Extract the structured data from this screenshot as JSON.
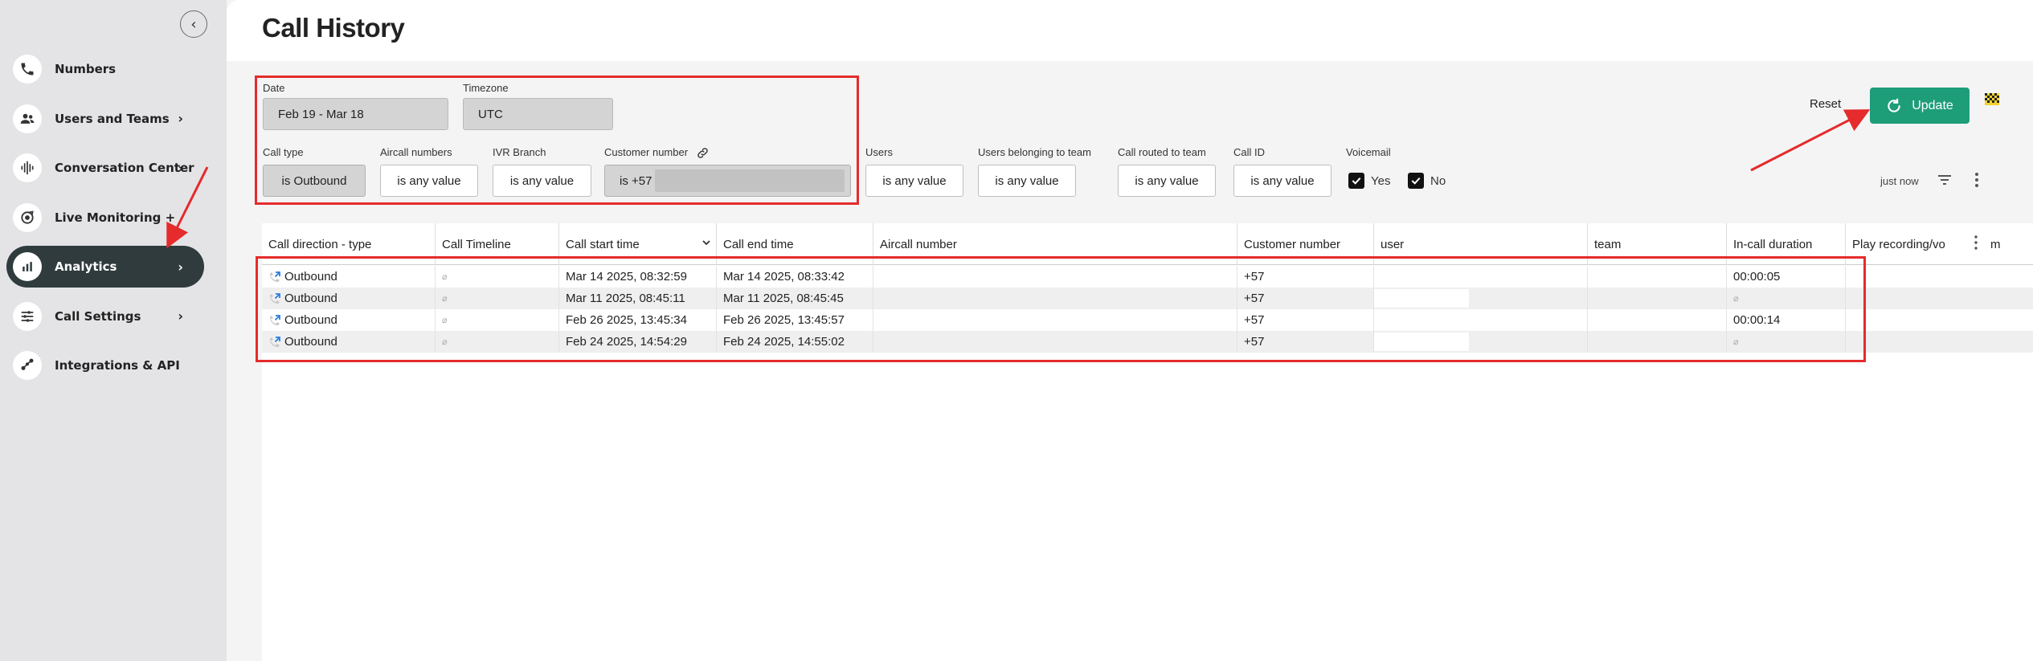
{
  "sidebar": {
    "collapse_glyph": "‹",
    "items": [
      {
        "label": "Numbers",
        "icon": "phone-icon"
      },
      {
        "label": "Users and Teams",
        "icon": "users-icon",
        "chevron": "›"
      },
      {
        "label": "Conversation Center",
        "icon": "waveform-icon",
        "chevron": "›"
      },
      {
        "label": "Live Monitoring +",
        "icon": "monitor-icon"
      },
      {
        "label": "Analytics",
        "icon": "analytics-icon",
        "chevron": "›",
        "active": true
      },
      {
        "label": "Call Settings",
        "icon": "sliders-icon",
        "chevron": "›"
      },
      {
        "label": "Integrations & API",
        "icon": "integrations-icon"
      }
    ]
  },
  "header": {
    "title": "Call History"
  },
  "filters": {
    "date": {
      "label": "Date",
      "value": "Feb 19 - Mar 18"
    },
    "timezone": {
      "label": "Timezone",
      "value": "UTC"
    },
    "call_type": {
      "label": "Call type",
      "value": "is Outbound"
    },
    "aircall_numbers": {
      "label": "Aircall numbers",
      "value": "is any value"
    },
    "ivr_branch": {
      "label": "IVR Branch",
      "value": "is any value"
    },
    "customer_number": {
      "label": "Customer number",
      "value": "is +57"
    },
    "users": {
      "label": "Users",
      "value": "is any value"
    },
    "users_team": {
      "label": "Users belonging to team",
      "value": "is any value"
    },
    "routed_team": {
      "label": "Call routed to team",
      "value": "is any value"
    },
    "call_id": {
      "label": "Call ID",
      "value": "is any value"
    },
    "voicemail": {
      "label": "Voicemail",
      "yes": "Yes",
      "no": "No"
    }
  },
  "actions": {
    "reset": "Reset",
    "update": "Update",
    "refreshed": "just now"
  },
  "table": {
    "columns": [
      "Call direction - type",
      "Call Timeline",
      "Call start time",
      "Call end time",
      "Aircall number",
      "Customer number",
      "user",
      "team",
      "In-call duration",
      "Play recording/vo",
      "m"
    ],
    "empty_glyph": "⌀",
    "rows": [
      {
        "direction": "Outbound",
        "start": "Mar 14 2025, 08:32:59",
        "end": "Mar 14 2025, 08:33:42",
        "customer": "+57",
        "duration": "00:00:05"
      },
      {
        "direction": "Outbound",
        "start": "Mar 11 2025, 08:45:11",
        "end": "Mar 11 2025, 08:45:45",
        "customer": "+57",
        "duration": ""
      },
      {
        "direction": "Outbound",
        "start": "Feb 26 2025, 13:45:34",
        "end": "Feb 26 2025, 13:45:57",
        "customer": "+57",
        "duration": "00:00:14"
      },
      {
        "direction": "Outbound",
        "start": "Feb 24 2025, 14:54:29",
        "end": "Feb 24 2025, 14:55:02",
        "customer": "+57",
        "duration": ""
      }
    ]
  },
  "colors": {
    "accent": "#1e9d79",
    "annotation": "#e52b2b",
    "sidebar_active": "#2f3b3d"
  }
}
